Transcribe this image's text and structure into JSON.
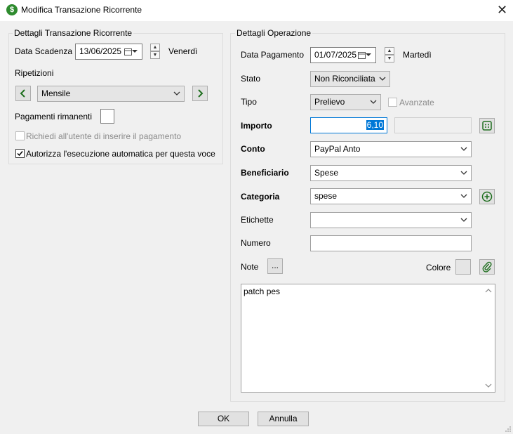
{
  "window": {
    "title": "Modifica Transazione Ricorrente",
    "app_icon": "$"
  },
  "left": {
    "legend": "Dettagli Transazione Ricorrente",
    "due_date_label": "Data Scadenza",
    "due_date_value": "13/06/2025",
    "due_day": "Venerdì",
    "repeat_label": "Ripetizioni",
    "repeat_value": "Mensile",
    "remaining_label": "Pagamenti rimanenti",
    "remaining_value": "",
    "ask_user_label": "Richiedi all'utente di inserire il pagamento",
    "ask_user_checked": false,
    "auto_exec_label": "Autorizza l'esecuzione automatica per questa voce",
    "auto_exec_checked": true
  },
  "right": {
    "legend": "Dettagli Operazione",
    "pay_date_label": "Data Pagamento",
    "pay_date_value": "01/07/2025",
    "pay_day": "Martedì",
    "status_label": "Stato",
    "status_value": "Non Riconciliata",
    "type_label": "Tipo",
    "type_value": "Prelievo",
    "advanced_label": "Avanzate",
    "amount_label": "Importo",
    "amount_value": "6,10",
    "account_label": "Conto",
    "account_value": "PayPal Anto",
    "payee_label": "Beneficiario",
    "payee_value": "Spese",
    "category_label": "Categoria",
    "category_value": "spese",
    "tags_label": "Etichette",
    "tags_value": "",
    "number_label": "Numero",
    "number_value": "",
    "notes_label": "Note",
    "notes_button": "...",
    "color_label": "Colore",
    "notes_text": "patch pes"
  },
  "footer": {
    "ok": "OK",
    "cancel": "Annulla"
  },
  "colors": {
    "accent_green": "#2e8b2e",
    "selection": "#0078d7"
  }
}
